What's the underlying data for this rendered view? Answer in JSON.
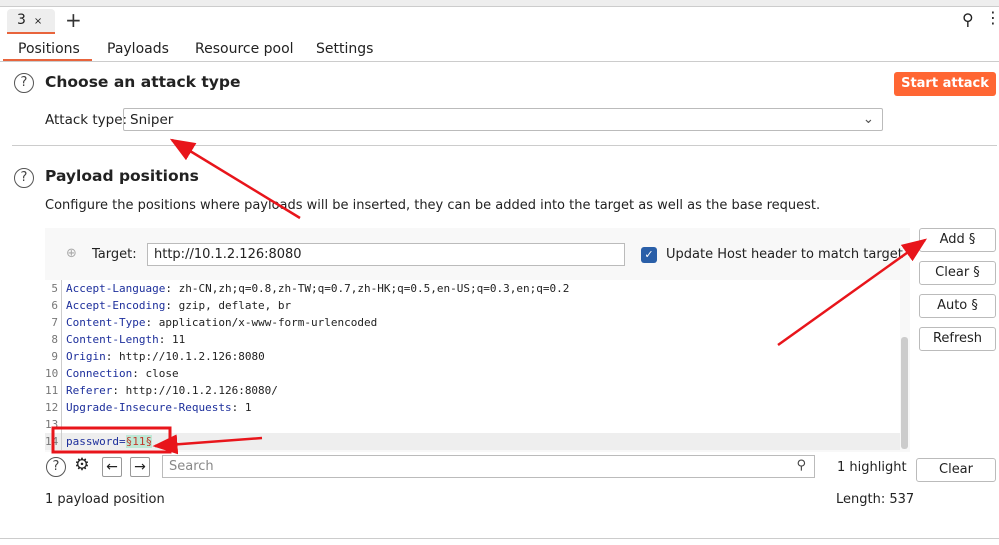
{
  "tab": {
    "label": "3",
    "close": "×",
    "add": "+"
  },
  "subtabs": [
    "Positions",
    "Payloads",
    "Resource pool",
    "Settings"
  ],
  "attack": {
    "heading": "Choose an attack type",
    "start": "Start attack",
    "label": "Attack type:",
    "value": "Sniper"
  },
  "positions": {
    "heading": "Payload positions",
    "description": "Configure the positions where payloads will be inserted, they can be added into the target as well as the base request.",
    "target_label": "Target:",
    "target_value": "http://10.1.2.126:8080",
    "update_host": "Update Host header to match target"
  },
  "buttons": {
    "add": "Add §",
    "clear": "Clear §",
    "auto": "Auto §",
    "refresh": "Refresh",
    "clear_search": "Clear"
  },
  "code": [
    {
      "n": "5",
      "k": "Accept-Language",
      "v": " zh-CN,zh;q=0.8,zh-TW;q=0.7,zh-HK;q=0.5,en-US;q=0.3,en;q=0.2"
    },
    {
      "n": "6",
      "k": "Accept-Encoding",
      "v": " gzip, deflate, br"
    },
    {
      "n": "7",
      "k": "Content-Type",
      "v": " application/x-www-form-urlencoded"
    },
    {
      "n": "8",
      "k": "Content-Length",
      "v": " 11"
    },
    {
      "n": "9",
      "k": "Origin",
      "v": " http://10.1.2.126:8080"
    },
    {
      "n": "10",
      "k": "Connection",
      "v": " close"
    },
    {
      "n": "11",
      "k": "Referer",
      "v": " http://10.1.2.126:8080/"
    },
    {
      "n": "12",
      "k": "Upgrade-Insecure-Requests",
      "v": " 1"
    },
    {
      "n": "13",
      "k": "",
      "v": ""
    },
    {
      "n": "14",
      "k": "password=",
      "v": "",
      "p": "§11§"
    }
  ],
  "search": {
    "placeholder": "Search",
    "highlights": "1 highlight"
  },
  "footer": {
    "count": "1 payload position",
    "length": "Length: 537"
  }
}
